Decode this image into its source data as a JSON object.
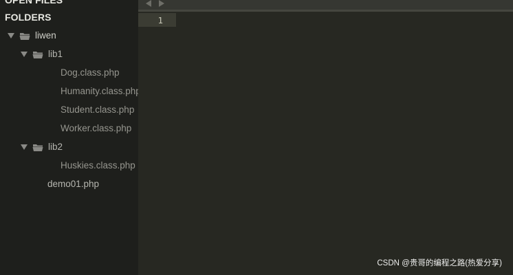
{
  "sidebar": {
    "open_files_header": "OPEN FILES",
    "folders_header": "FOLDERS",
    "tree": [
      {
        "label": "liwen",
        "type": "folder",
        "expanded": true
      },
      {
        "label": "lib1",
        "type": "folder",
        "expanded": true
      },
      {
        "label": "Dog.class.php",
        "type": "file"
      },
      {
        "label": "Humanity.class.php",
        "type": "file"
      },
      {
        "label": "Student.class.php",
        "type": "file"
      },
      {
        "label": "Worker.class.php",
        "type": "file"
      },
      {
        "label": "lib2",
        "type": "folder",
        "expanded": true
      },
      {
        "label": "Huskies.class.php",
        "type": "file"
      },
      {
        "label": "demo01.php",
        "type": "file"
      }
    ]
  },
  "editor": {
    "line_numbers": [
      "1"
    ]
  },
  "watermark": "CSDN @贵哥的编程之路(热爱分享)",
  "colors": {
    "sidebar_bg": "#1e1f1c",
    "editor_bg": "#272822",
    "current_line_bg": "#3b3c33"
  }
}
